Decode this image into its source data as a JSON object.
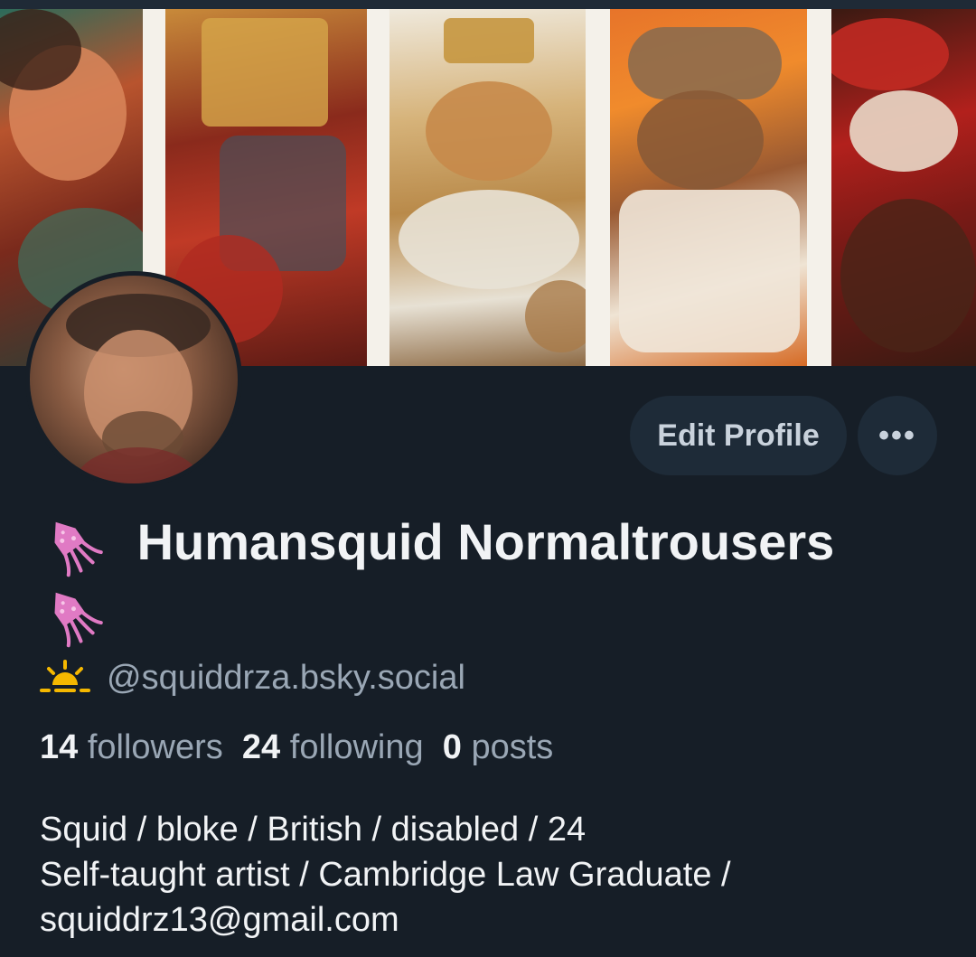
{
  "profile": {
    "display_name": "Humansquid Normaltrousers",
    "name_emoji": "squid-icon",
    "handle_icon": "sunrise-icon",
    "handle": "@squiddrza.bsky.social",
    "bio_lines": [
      "Squid / bloke / British / disabled / 24",
      "Self-taught artist / Cambridge Law Graduate /",
      "squiddrz13@gmail.com"
    ]
  },
  "stats": {
    "followers_count": "14",
    "followers_label": "followers",
    "following_count": "24",
    "following_label": "following",
    "posts_count": "0",
    "posts_label": "posts"
  },
  "actions": {
    "edit_label": "Edit Profile",
    "more_label": "•••"
  },
  "colors": {
    "background": "#161e27",
    "button_bg": "#1e2b38",
    "muted_text": "#9aa7b5",
    "primary_text": "#f1f3f5"
  }
}
